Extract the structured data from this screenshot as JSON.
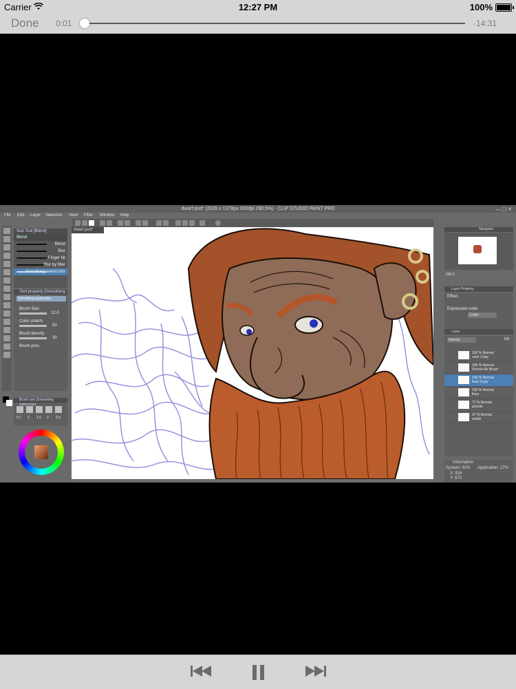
{
  "status_bar": {
    "carrier": "Carrier",
    "time": "12:27 PM",
    "battery": "100%",
    "icons": [
      "wifi-icon",
      "battery-icon"
    ]
  },
  "player": {
    "done_label": "Done",
    "elapsed": "0:01",
    "remaining": "-14:31",
    "progress_fraction": 0.001,
    "controls": [
      "previous-icon",
      "pause-icon",
      "next-icon"
    ]
  },
  "video": {
    "window_title": "dwarf.psd* (2035 x 1378px 350dpi 290.5%) - CLIP STUDIO PAINT PRO",
    "menu": [
      "File",
      "Edit",
      "Layer",
      "Selection",
      "View",
      "Filter",
      "Window",
      "Help"
    ],
    "canvas_tab": "dwarf.psd*",
    "subtool_header": "Sub Tool [Blend]",
    "subtool_tab": "Blend",
    "subtools": [
      "Blend",
      "Blur",
      "Finger tip",
      "Blur by filter",
      "Smoothing watercolor"
    ],
    "tool_property_header": "Tool property [Smoothing watercolor]",
    "tool_property_name": "Smoothing watercolor",
    "properties": [
      {
        "label": "Brush Size",
        "value": "12.0"
      },
      {
        "label": "Color stretch",
        "value": "50"
      },
      {
        "label": "Brush density",
        "value": "30"
      },
      {
        "label": "Brush prec.",
        "value": ""
      }
    ],
    "brush_size_header": "Brush size [Smoothing watercolor]",
    "brush_sizes": [
      "0.7",
      "1",
      "1.5",
      "2",
      "2.5"
    ],
    "right_panel": {
      "navigator_label": "Navigator",
      "zoom": "290.5",
      "layer_property_label": "Layer Property",
      "effect_label": "Effect",
      "expression_color_label": "Expression color",
      "expression_color_value": "Color",
      "layer_label": "Layer",
      "blend_mode": "Normal",
      "opacity": "100",
      "layers": [
        {
          "percent": "100 %",
          "mode": "Normal",
          "name": "color Copy"
        },
        {
          "percent": "100 %",
          "mode": "Normal",
          "name": "Pencils Air Brush"
        },
        {
          "percent": "100 %",
          "mode": "Normal",
          "name": "lines Copy"
        },
        {
          "percent": "100 %",
          "mode": "Normal",
          "name": "lines"
        },
        {
          "percent": "71 %",
          "mode": "Normal",
          "name": "pencils"
        },
        {
          "percent": "37 %",
          "mode": "Normal",
          "name": "studio"
        }
      ],
      "selected_layer_index": 2,
      "info_label": "Information",
      "system_usage": "System: 32%",
      "app_usage": "Application: 17%",
      "info_x": "X: 916",
      "info_y": "Y: 672"
    }
  }
}
